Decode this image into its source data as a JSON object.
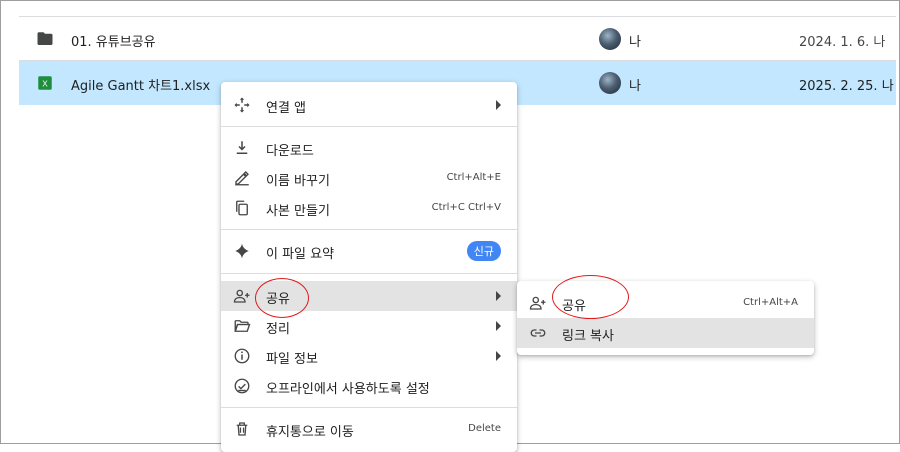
{
  "files": [
    {
      "name": "01. 유튜브공유",
      "owner": "나",
      "date": "2024. 1. 6. 나",
      "type": "folder"
    },
    {
      "name": "Agile Gantt 차트1.xlsx",
      "owner": "나",
      "date": "2025. 2. 25. 나",
      "type": "excel"
    }
  ],
  "excel_letter": "X",
  "context_menu": {
    "open_with": "연결 앱",
    "download": "다운로드",
    "rename": "이름 바꾸기",
    "rename_shortcut": "Ctrl+Alt+E",
    "copy": "사본 만들기",
    "copy_shortcut": "Ctrl+C Ctrl+V",
    "summarize": "이 파일 요약",
    "new_badge": "신규",
    "share": "공유",
    "organize": "정리",
    "file_info": "파일 정보",
    "offline": "오프라인에서 사용하도록 설정",
    "trash": "휴지통으로 이동",
    "trash_shortcut": "Delete"
  },
  "share_submenu": {
    "share": "공유",
    "share_shortcut": "Ctrl+Alt+A",
    "copy_link": "링크 복사"
  },
  "colors": {
    "selected_row": "#c2e7ff",
    "hover": "#e3e3e3",
    "badge": "#4285f4",
    "annotation": "#e01b1b",
    "excel": "#1e8e3e"
  }
}
